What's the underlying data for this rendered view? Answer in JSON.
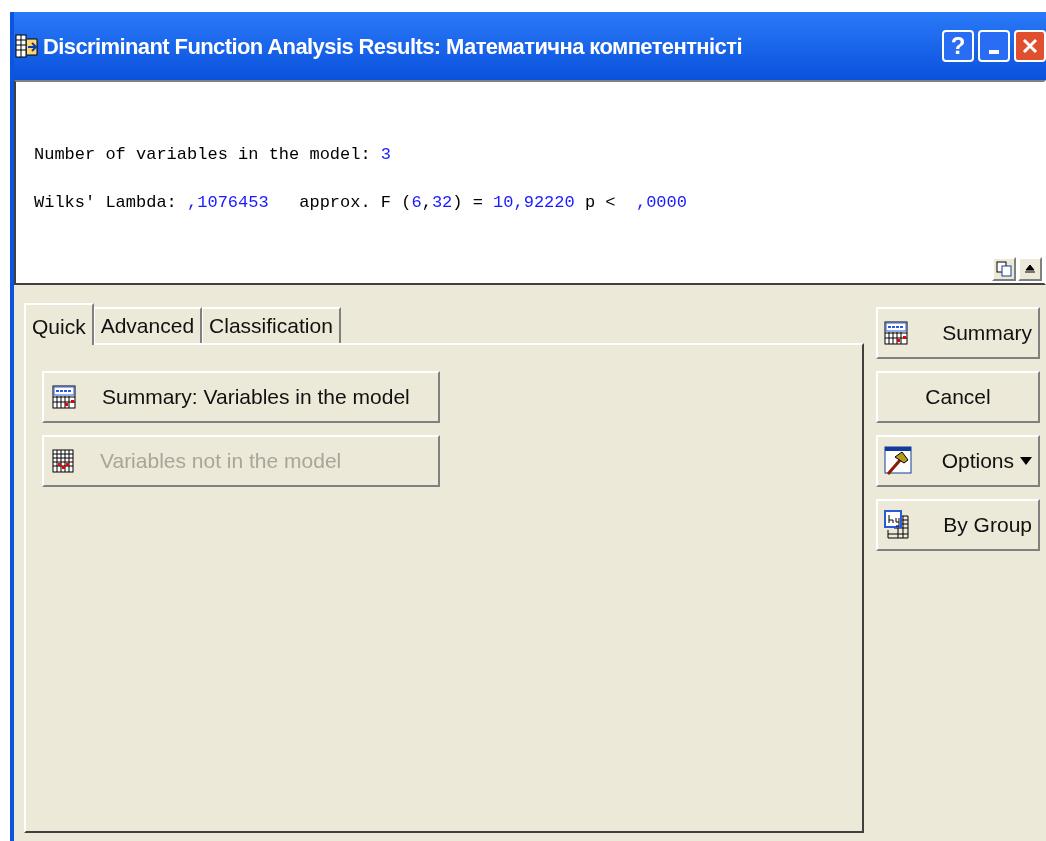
{
  "window": {
    "title": "Discriminant Function Analysis Results: Математична компетентністі",
    "buttons": [
      {
        "kind": "help",
        "label": "?"
      },
      {
        "kind": "minimize"
      },
      {
        "kind": "close"
      }
    ]
  },
  "output": {
    "lines": [
      [
        {
          "kind": "label",
          "text": "Number of variables in the model: "
        },
        {
          "kind": "value",
          "text": "3"
        }
      ],
      [
        {
          "kind": "label",
          "text": "Wilks' Lambda: "
        },
        {
          "kind": "value",
          "text": ",1076453"
        },
        {
          "kind": "label",
          "text": "   approx. F ("
        },
        {
          "kind": "value",
          "text": "6"
        },
        {
          "kind": "label",
          "text": ","
        },
        {
          "kind": "value",
          "text": "32"
        },
        {
          "kind": "label",
          "text": ") = "
        },
        {
          "kind": "value",
          "text": "10,92220"
        },
        {
          "kind": "label",
          "text": " p <  "
        },
        {
          "kind": "value",
          "text": ",0000"
        }
      ]
    ]
  },
  "tabs": [
    {
      "label": "Quick",
      "selected": true
    },
    {
      "label": "Advanced",
      "selected": false
    },
    {
      "label": "Classification",
      "selected": false
    }
  ],
  "quick_buttons": [
    {
      "label": "Summary:  Variables in the model",
      "kind": "summary",
      "disabled": false
    },
    {
      "label": "Variables not in the model",
      "kind": "grid",
      "disabled": true
    }
  ],
  "side_buttons": [
    {
      "label": "Summary",
      "kind": "summary",
      "dropdown": false
    },
    {
      "label": "Cancel",
      "kind": "plain",
      "dropdown": false
    },
    {
      "label": "Options",
      "kind": "options",
      "dropdown": true
    },
    {
      "label": "By Group",
      "kind": "bygroup",
      "dropdown": false
    }
  ]
}
